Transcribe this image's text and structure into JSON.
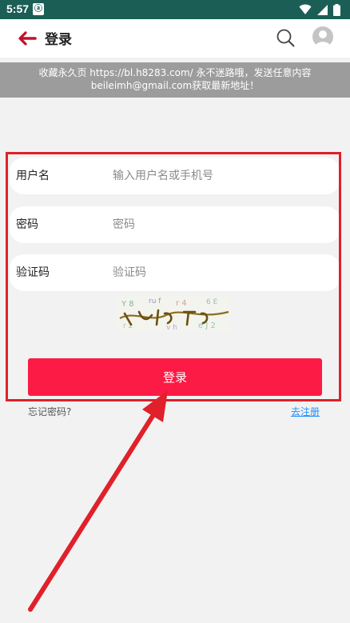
{
  "status_bar": {
    "time": "5:57",
    "app_icon_text": "ⓐ",
    "icons": [
      "wifi-icon",
      "signal-icon",
      "battery-icon"
    ]
  },
  "header": {
    "title": "登录",
    "back_icon": "arrow-left-icon",
    "search_icon": "search-icon",
    "avatar_icon": "user-avatar-icon"
  },
  "notice": {
    "line1": "收藏永久页 https://bl.h8283.com/ 永不迷路哦，发送任意内容",
    "line2": "beileimh@gmail.com获取最新地址！"
  },
  "form": {
    "username": {
      "label": "用户名",
      "placeholder": "输入用户名或手机号"
    },
    "password": {
      "label": "密码",
      "placeholder": "密码"
    },
    "captcha": {
      "label": "验证码",
      "placeholder": "验证码"
    },
    "submit_label": "登录",
    "forgot_label": "忘记密码?",
    "register_label": "去注册"
  },
  "colors": {
    "status_bar": "#1b5e56",
    "accent": "#fc1b45",
    "link": "#1e90ff",
    "annotation": "#e0202a",
    "notice_bg": "#9c9c9c"
  }
}
